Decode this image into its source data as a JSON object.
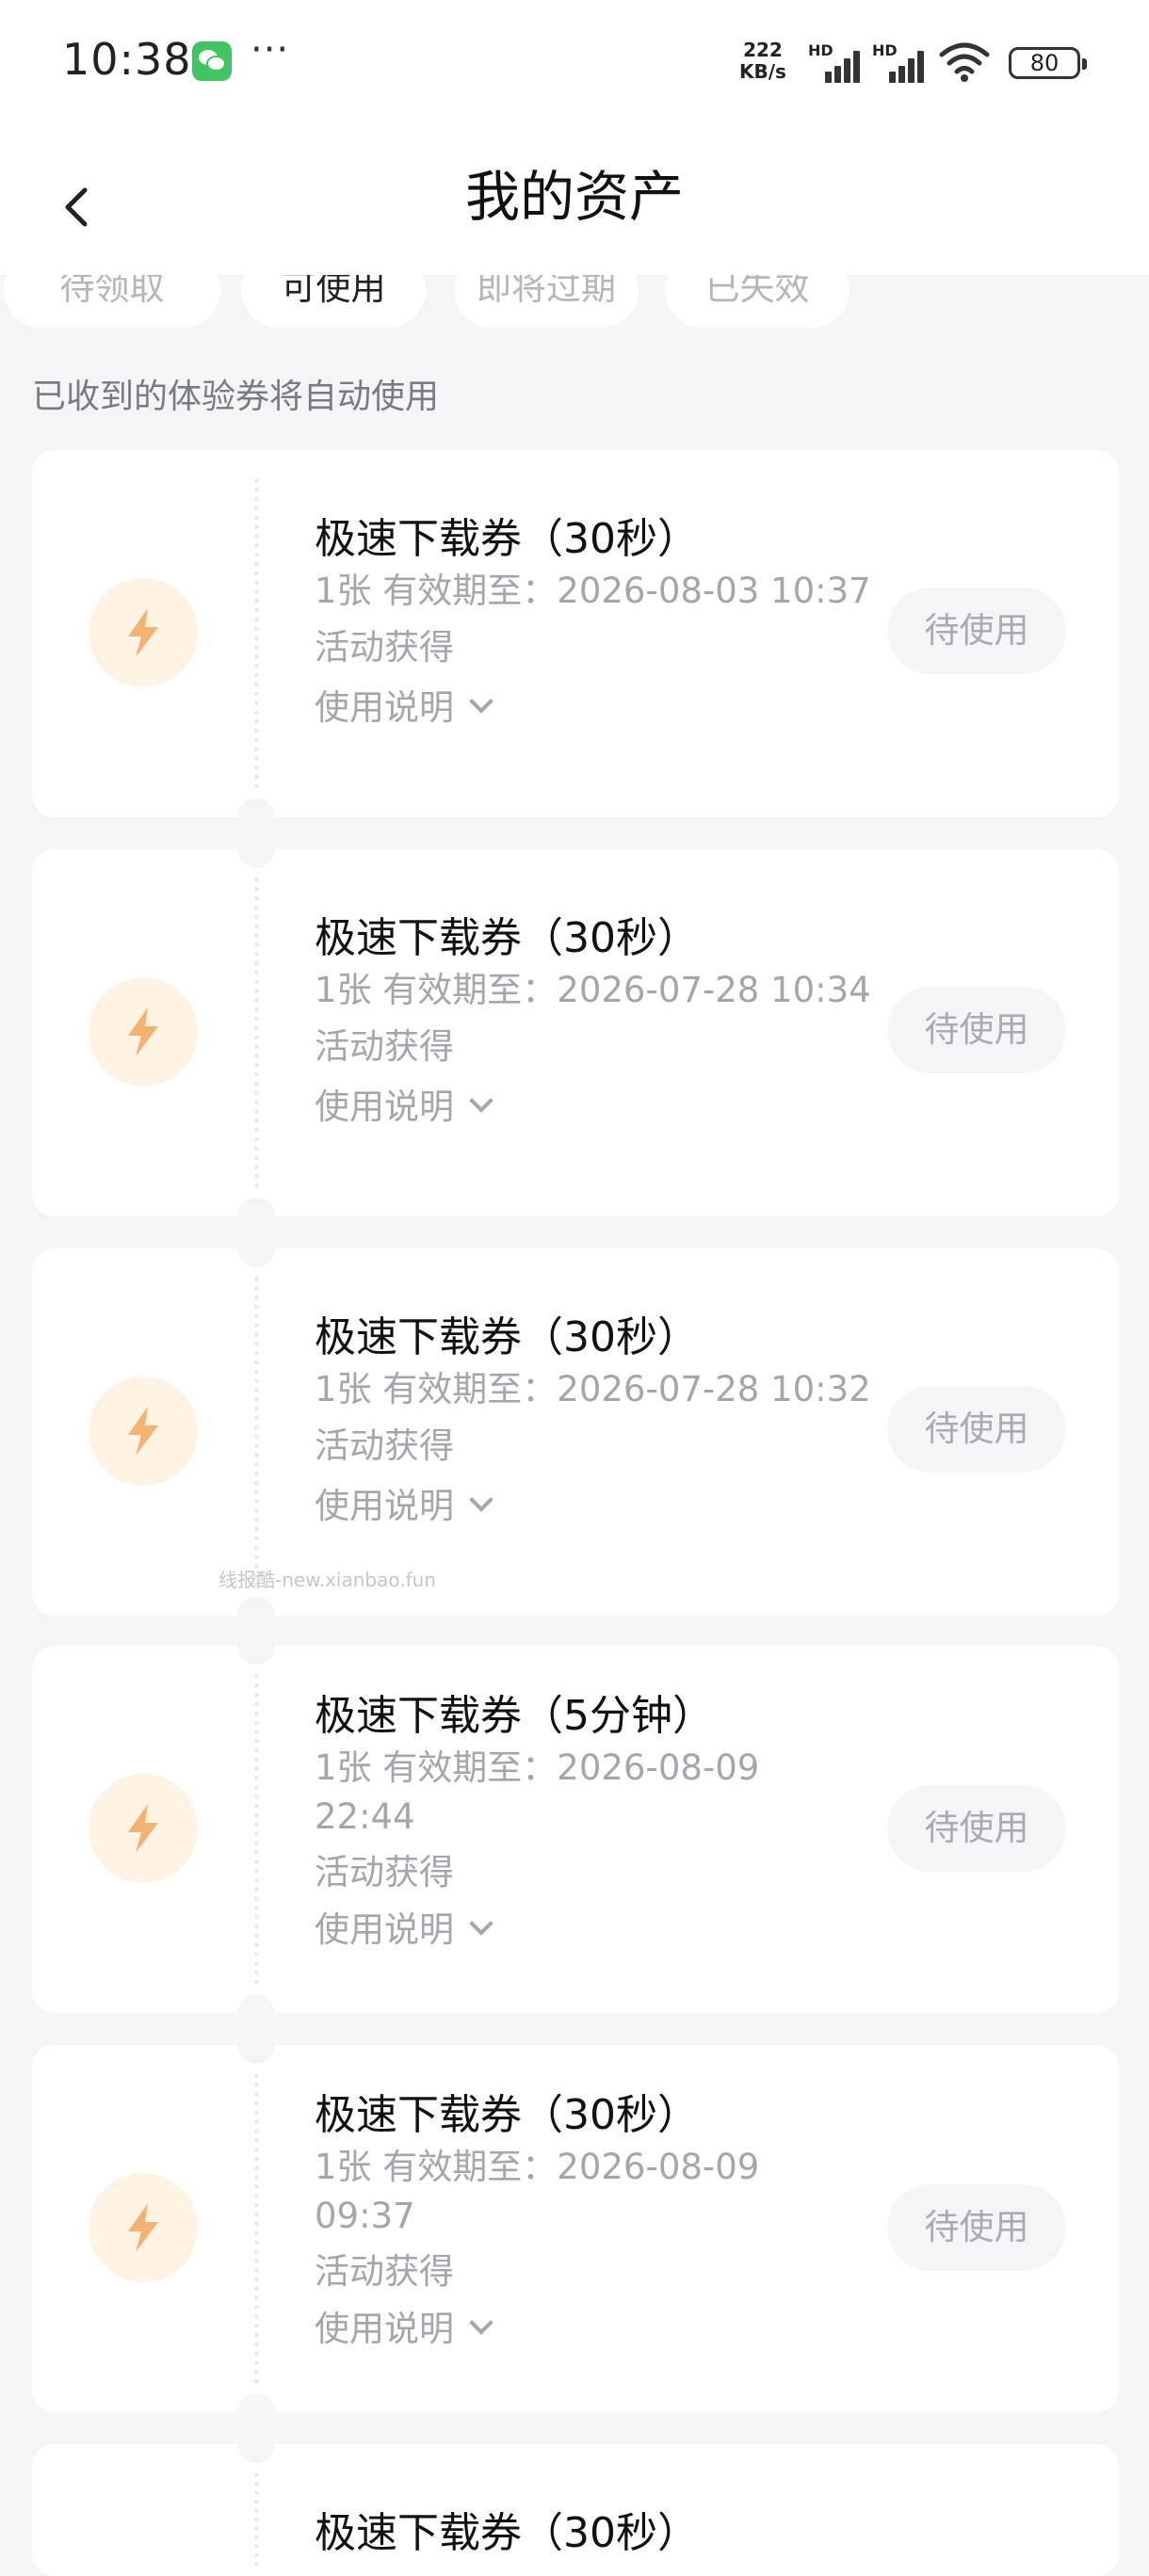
{
  "status_bar": {
    "time": "10:38",
    "more": "···",
    "net_speed_value": "222",
    "net_speed_unit": "KB/s",
    "sim1": "HD",
    "sim2": "HD",
    "battery": "80"
  },
  "header": {
    "title": "我的资产"
  },
  "tabs": [
    {
      "label": "待领取",
      "active": false
    },
    {
      "label": "可使用",
      "active": true
    },
    {
      "label": "即将过期",
      "active": false
    },
    {
      "label": "已失效",
      "active": false
    }
  ],
  "hint": "已收到的体验券将自动使用",
  "coupons": [
    {
      "title": "极速下载券（30秒）",
      "validity": "1张 有效期至：2026-08-03 10:37",
      "source": "活动获得",
      "desc_label": "使用说明",
      "button": "待使用"
    },
    {
      "title": "极速下载券（30秒）",
      "validity": "1张 有效期至：2026-07-28 10:34",
      "source": "活动获得",
      "desc_label": "使用说明",
      "button": "待使用"
    },
    {
      "title": "极速下载券（30秒）",
      "validity": "1张 有效期至：2026-07-28 10:32",
      "source": "活动获得",
      "desc_label": "使用说明",
      "button": "待使用"
    },
    {
      "title": "极速下载券（5分钟）",
      "validity": "1张 有效期至：2026-08-09 22:44",
      "source": "活动获得",
      "desc_label": "使用说明",
      "button": "待使用"
    },
    {
      "title": "极速下载券（30秒）",
      "validity": "1张 有效期至：2026-08-09 09:37",
      "source": "活动获得",
      "desc_label": "使用说明",
      "button": "待使用"
    },
    {
      "title": "极速下载券（30秒）",
      "validity": "",
      "source": "",
      "desc_label": "",
      "button": ""
    }
  ],
  "watermark": "线报酷-new.xianbao.fun",
  "colors": {
    "accent_orange": "#f3b272",
    "icon_bg": "#fff3e4",
    "page_bg": "#f4f5f7",
    "muted_text": "#a3a6ad"
  },
  "icons": {
    "back": "chevron-left-icon",
    "coupon": "lightning-bolt-icon",
    "expand": "chevron-down-icon"
  }
}
